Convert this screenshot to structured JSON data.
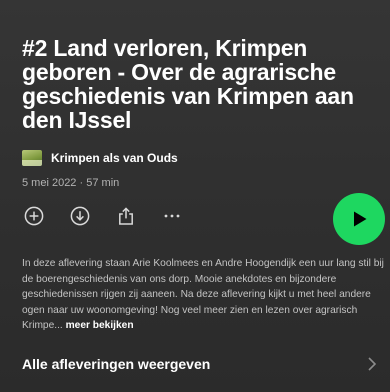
{
  "episode": {
    "title": "#2 Land verloren, Krimpen geboren - Over de agrarische geschiedenis van Krimpen aan den IJssel",
    "show_name": "Krimpen als van Ouds",
    "date": "5 mei 2022",
    "separator": "·",
    "duration": "57 min",
    "description": "In deze aflevering staan Arie Koolmees en Andre Hoogendijk een uur lang stil bij de boerengeschiedenis van ons dorp. Mooie anekdotes en bijzondere geschiedenissen rijgen zij aaneen. Na deze aflevering kijkt u met heel andere ogen naar uw woonomgeving! Nog veel meer zien en lezen over agrarisch Krimpe...",
    "more_label": "meer bekijken"
  },
  "all_episodes_label": "Alle afleveringen weergeven",
  "colors": {
    "accent": "#1ed760",
    "background": "#2f2f2f",
    "secondary_text": "#b3b3b3"
  },
  "icons": {
    "add": "plus-circle-icon",
    "download": "download-circle-icon",
    "share": "share-icon",
    "more": "more-dots-icon",
    "play": "play-icon",
    "chevron": "chevron-right-icon",
    "show_logo": "show-logo"
  }
}
